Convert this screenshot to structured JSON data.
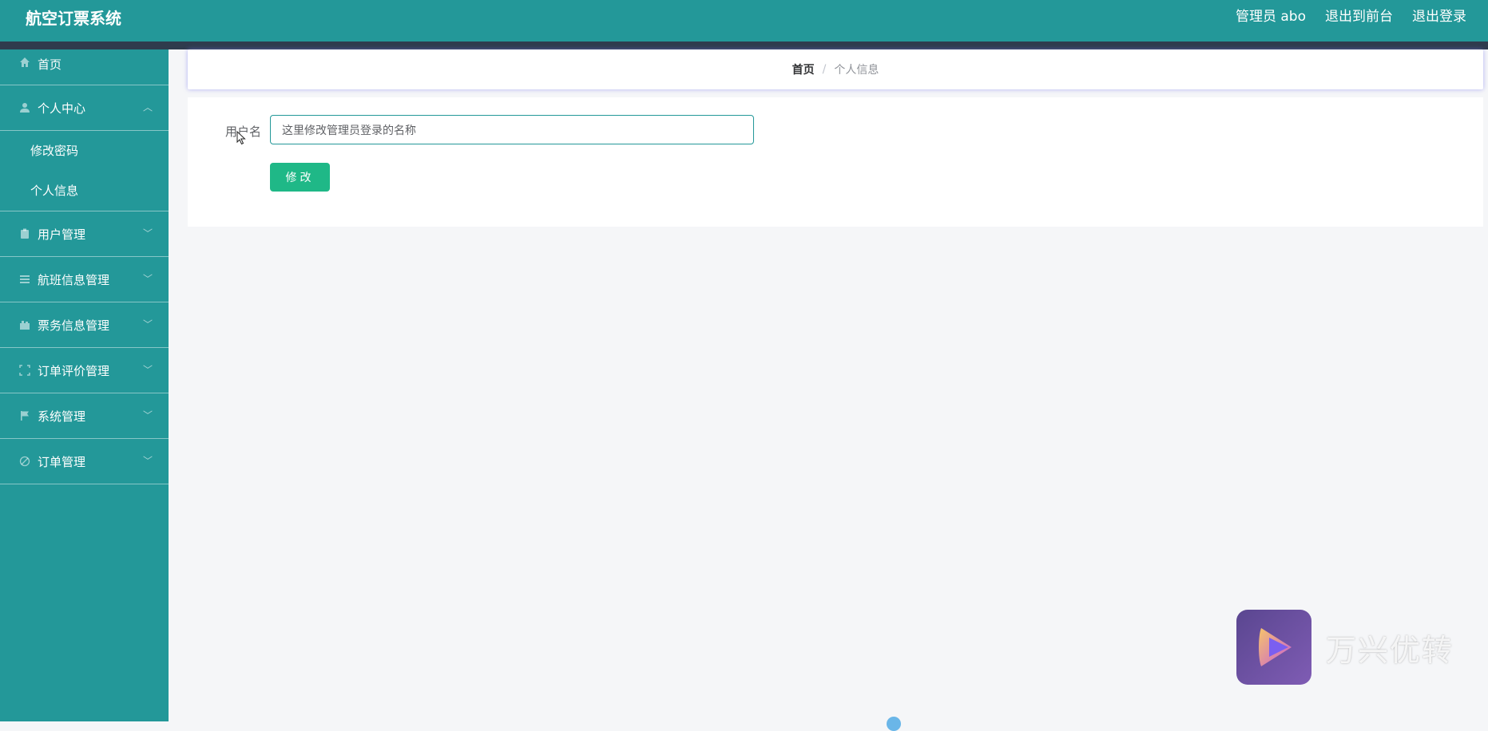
{
  "header": {
    "title": "航空订票系统",
    "admin_label": "管理员 abo",
    "back_to_front": "退出到前台",
    "logout": "退出登录"
  },
  "sidebar": {
    "items": [
      {
        "label": "首页",
        "icon": "home-icon"
      },
      {
        "label": "个人中心",
        "icon": "user-icon",
        "expanded": true,
        "children": [
          {
            "label": "修改密码"
          },
          {
            "label": "个人信息"
          }
        ]
      },
      {
        "label": "用户管理",
        "icon": "clipboard-icon"
      },
      {
        "label": "航班信息管理",
        "icon": "list-icon"
      },
      {
        "label": "票务信息管理",
        "icon": "ticket-icon"
      },
      {
        "label": "订单评价管理",
        "icon": "frame-icon"
      },
      {
        "label": "系统管理",
        "icon": "flag-icon"
      },
      {
        "label": "订单管理",
        "icon": "tag-icon"
      }
    ]
  },
  "breadcrumb": {
    "home": "首页",
    "separator": "/",
    "current": "个人信息"
  },
  "form": {
    "username_label": "用户名",
    "username_value": "这里修改管理员登录的名称",
    "submit_label": "修改"
  },
  "watermark": {
    "text": "万兴优转"
  },
  "colors": {
    "primary": "#239899",
    "dark_strip": "#2f3b4d",
    "button": "#1fb887",
    "background": "#f5f6f8"
  }
}
